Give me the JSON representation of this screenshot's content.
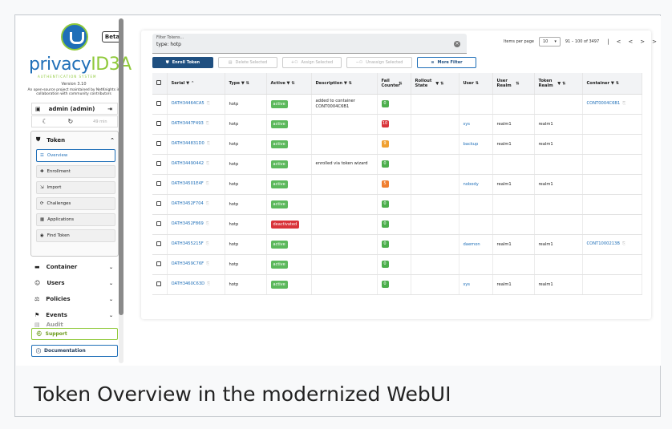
{
  "brand": {
    "name_a": "privacy",
    "name_b": "ID",
    "name_c": "3A",
    "subtitle": "AUTHENTICATION SYSTEM",
    "beta": "Beta",
    "version": "Version 3.10",
    "credits": "An open-source project maintained by NetKnights in collaboration with community contributors"
  },
  "user": {
    "label": "admin (admin)"
  },
  "pref": {
    "session": "49 min"
  },
  "nav": {
    "token_label": "Token",
    "sub_items": [
      "Overview",
      "Enrollment",
      "Import",
      "Challenges",
      "Applications",
      "Find Token"
    ],
    "items": [
      "Container",
      "Users",
      "Policies",
      "Events",
      "Audit"
    ],
    "support": "Support",
    "documentation": "Documentation"
  },
  "filter": {
    "placeholder": "Filter Tokens...",
    "value": "type: hotp"
  },
  "pager": {
    "label": "Items per page",
    "per_page": "10",
    "range": "91 – 100 of 3497"
  },
  "toolbar": {
    "enroll": "Enroll Token",
    "delete": "Delete Selected",
    "assign": "Assign Selected",
    "unassign": "Unassign Selected",
    "more_filter": "More Filter"
  },
  "columns": [
    "Serial",
    "Type",
    "Active",
    "Description",
    "Fail Counter",
    "Rollout State",
    "User",
    "User Realm",
    "Token Realm",
    "Container"
  ],
  "rows": [
    {
      "serial": "OATH34464CA5",
      "type": "hotp",
      "active": "active",
      "description": "added to container CONT0004C6B1",
      "fail": "0",
      "user": "",
      "urealm": "",
      "trealm": "",
      "container": "CONT0004C6B1"
    },
    {
      "serial": "OATH3447F493",
      "type": "hotp",
      "active": "active",
      "description": "",
      "fail": "10",
      "user": "sys",
      "urealm": "realm1",
      "trealm": "realm1",
      "container": ""
    },
    {
      "serial": "OATH344831D0",
      "type": "hotp",
      "active": "active",
      "description": "",
      "fail": "9",
      "user": "backup",
      "urealm": "realm1",
      "trealm": "realm1",
      "container": ""
    },
    {
      "serial": "OATH34490442",
      "type": "hotp",
      "active": "active",
      "description": "enrolled via token wizard",
      "fail": "0",
      "user": "",
      "urealm": "",
      "trealm": "",
      "container": ""
    },
    {
      "serial": "OATH34501E4F",
      "type": "hotp",
      "active": "active",
      "description": "",
      "fail": "5",
      "user": "nobody",
      "urealm": "realm1",
      "trealm": "realm1",
      "container": ""
    },
    {
      "serial": "OATH3452F704",
      "type": "hotp",
      "active": "active",
      "description": "",
      "fail": "0",
      "user": "",
      "urealm": "",
      "trealm": "",
      "container": ""
    },
    {
      "serial": "OATH3452F869",
      "type": "hotp",
      "active": "deactivated",
      "description": "",
      "fail": "0",
      "user": "",
      "urealm": "",
      "trealm": "",
      "container": ""
    },
    {
      "serial": "OATH3455215F",
      "type": "hotp",
      "active": "active",
      "description": "",
      "fail": "0",
      "user": "daemon",
      "urealm": "realm1",
      "trealm": "realm1",
      "container": "CONT1000213B"
    },
    {
      "serial": "OATH3459C76F",
      "type": "hotp",
      "active": "active",
      "description": "",
      "fail": "0",
      "user": "",
      "urealm": "",
      "trealm": "",
      "container": ""
    },
    {
      "serial": "OATH3460C63D",
      "type": "hotp",
      "active": "active",
      "description": "",
      "fail": "0",
      "user": "sys",
      "urealm": "realm1",
      "trealm": "realm1",
      "container": ""
    }
  ],
  "caption": "Token Overview in the modernized WebUI",
  "colors": {
    "primary": "#1f4f80",
    "link": "#1f6fb8",
    "accent_green": "#8fc93a",
    "active": "#5cb85c",
    "deactivated": "#d9343a"
  }
}
